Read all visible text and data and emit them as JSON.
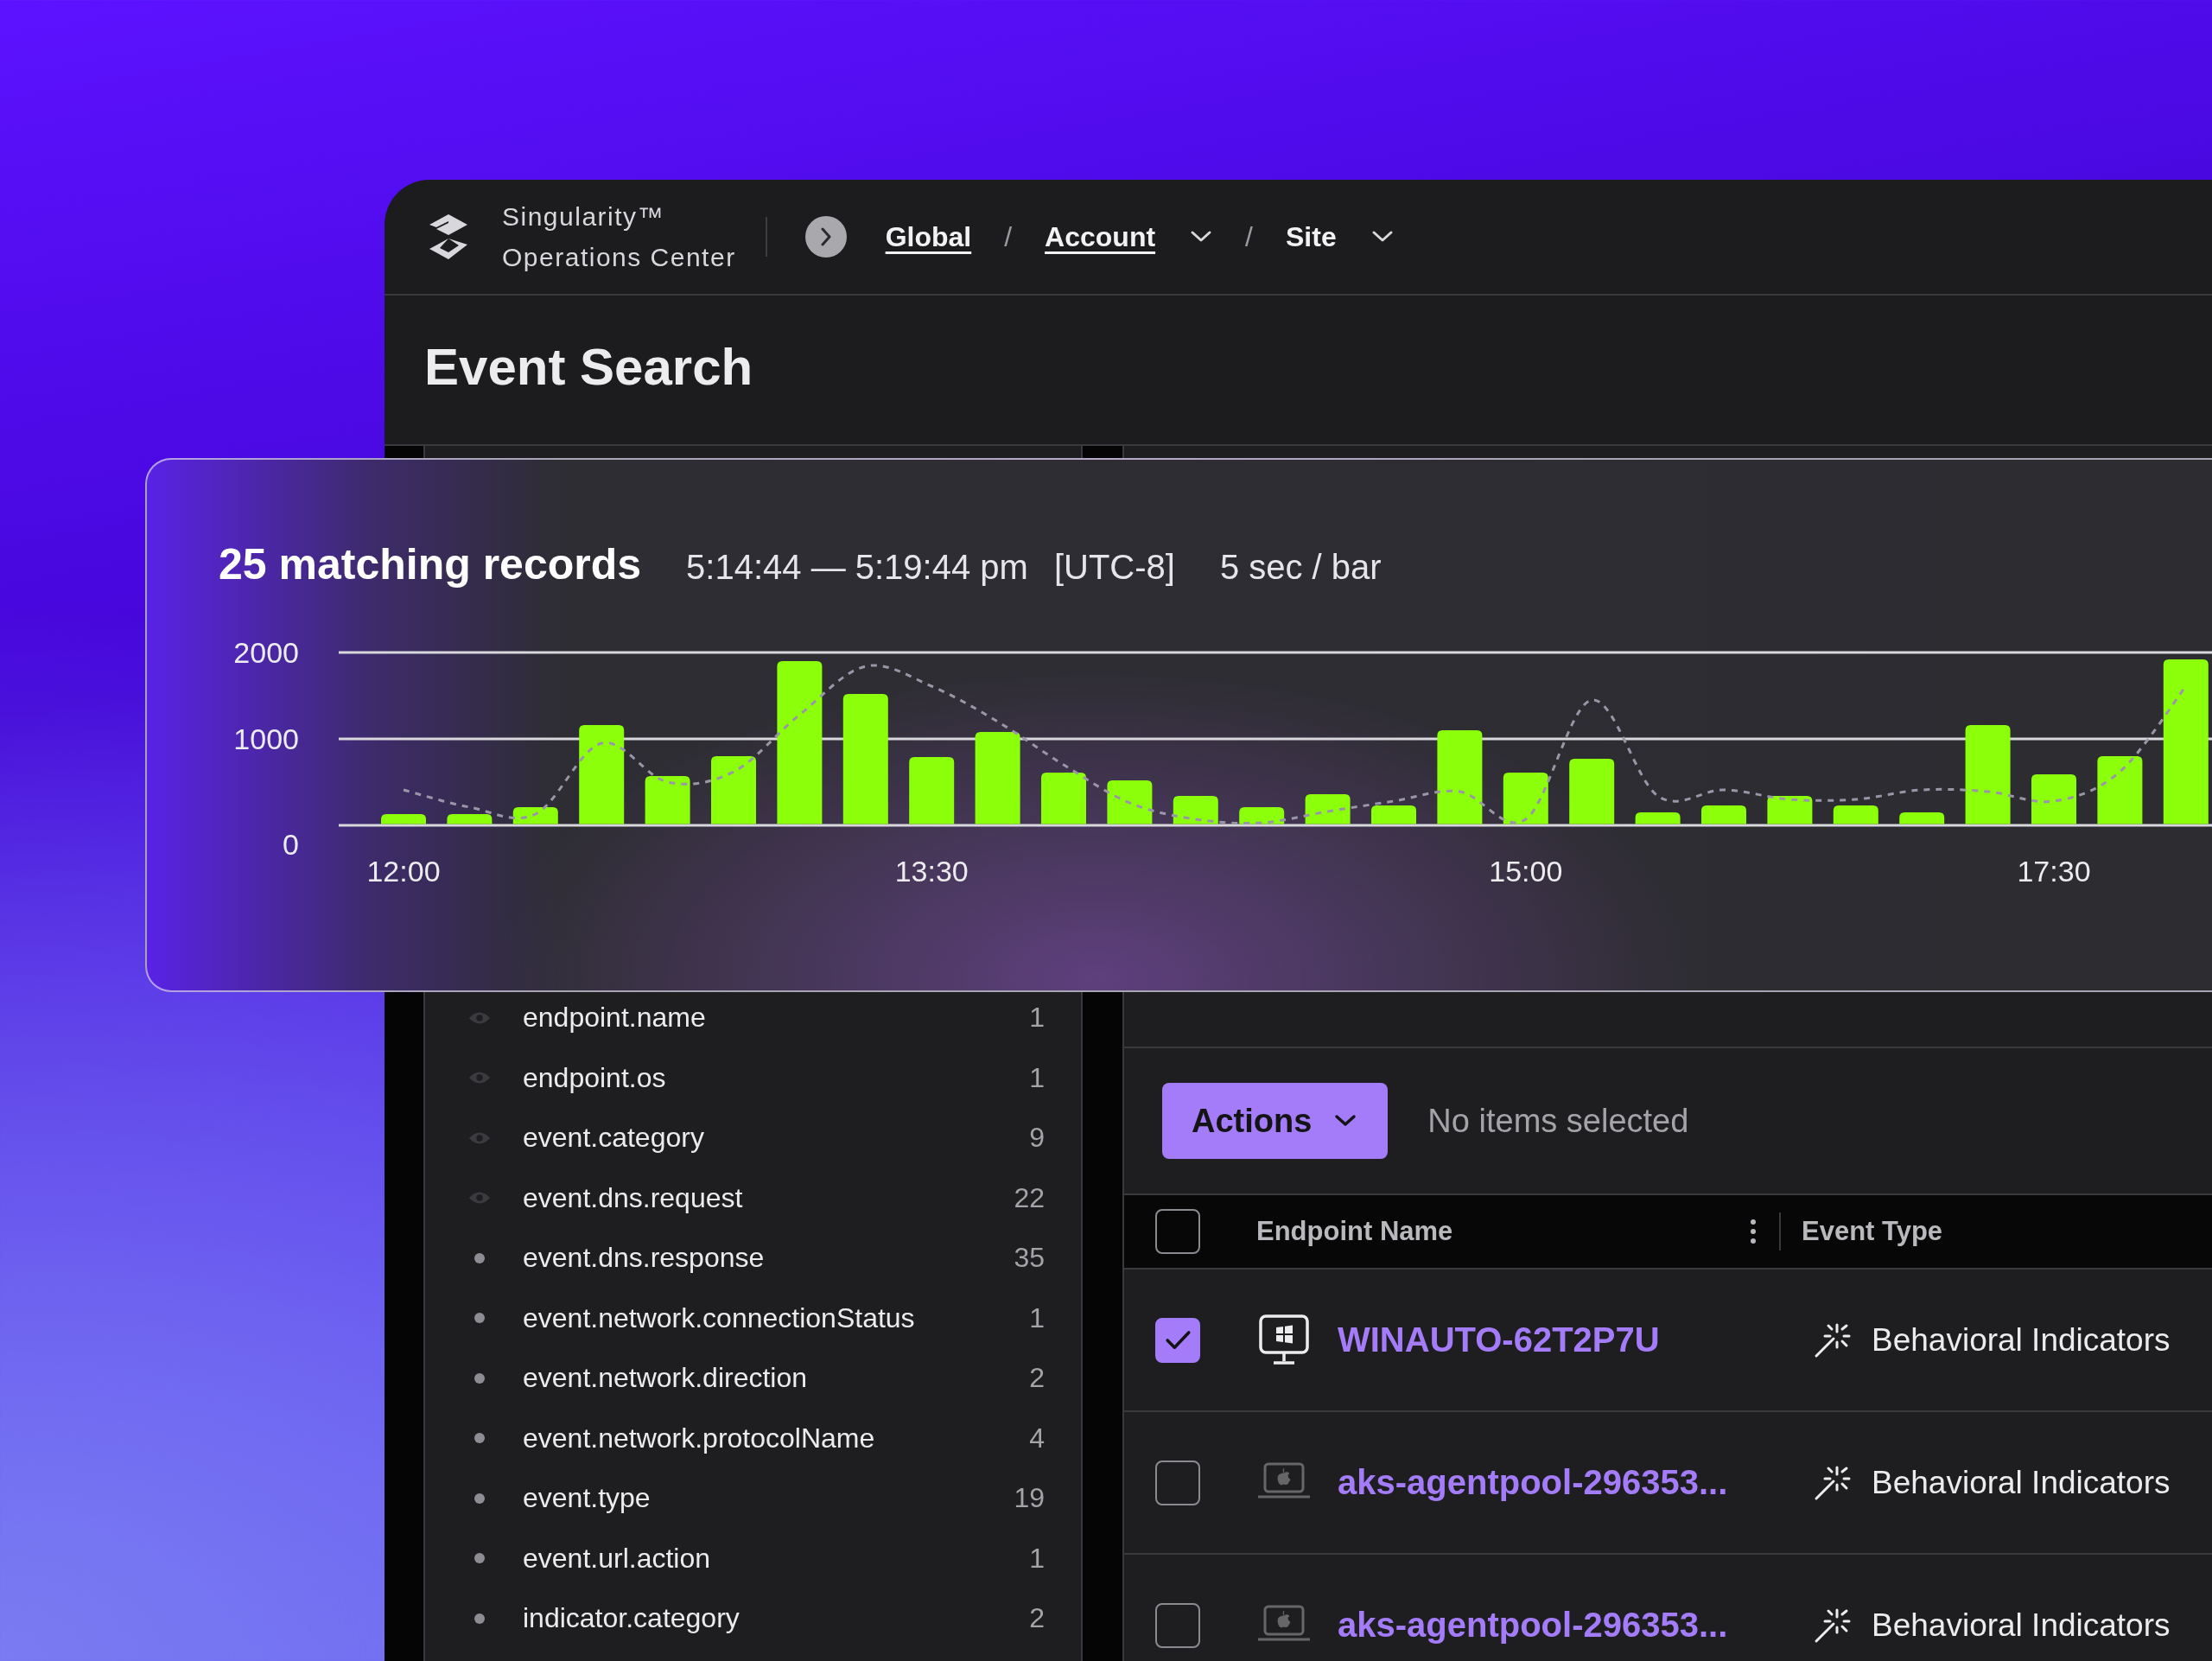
{
  "header": {
    "product_name": "Singularity™",
    "product_subtitle": "Operations Center",
    "breadcrumbs": [
      {
        "kind": "crumb",
        "label": "Global",
        "underlined": true,
        "dropdown": false
      },
      {
        "kind": "separator",
        "label": "/"
      },
      {
        "kind": "crumb",
        "label": "Account",
        "underlined": true,
        "dropdown": true
      },
      {
        "kind": "separator",
        "label": "/"
      },
      {
        "kind": "crumb",
        "label": "Site",
        "underlined": false,
        "dropdown": true
      }
    ]
  },
  "page_title": "Event Search",
  "histogram": {
    "title": "25 matching records",
    "time_range": "5:14:44 — 5:19:44 pm",
    "timezone": "[UTC-8]",
    "interval": "5 sec / bar",
    "chart_data": {
      "type": "bar",
      "categories": [
        "12:00",
        null,
        null,
        null,
        null,
        null,
        null,
        null,
        "13:30",
        null,
        null,
        null,
        null,
        null,
        null,
        null,
        null,
        "15:00",
        null,
        null,
        null,
        null,
        null,
        null,
        null,
        "17:30",
        null,
        null
      ],
      "series": [
        {
          "color": "#8cff0a",
          "values": [
            130,
            130,
            210,
            1160,
            570,
            800,
            1900,
            1520,
            790,
            1080,
            610,
            520,
            340,
            210,
            360,
            230,
            1100,
            610,
            770,
            150,
            230,
            340,
            230,
            150,
            1160,
            590,
            800,
            1920
          ]
        },
        {
          "type": "line",
          "line_style": "dashed",
          "color": "#9a96a8",
          "values": [
            410,
            210,
            130,
            950,
            500,
            620,
            1280,
            1840,
            1610,
            1200,
            700,
            260,
            70,
            30,
            160,
            280,
            390,
            70,
            1450,
            340,
            410,
            300,
            300,
            410,
            390,
            280,
            620,
            1610
          ]
        }
      ],
      "ylim": [
        0,
        2000
      ],
      "yticks": [
        0,
        1000,
        2000
      ]
    }
  },
  "fields_panel": {
    "items": [
      {
        "kind": "eye",
        "name": "endpoint.name",
        "count": "1"
      },
      {
        "kind": "eye",
        "name": "endpoint.os",
        "count": "1"
      },
      {
        "kind": "eye",
        "name": "event.category",
        "count": "9"
      },
      {
        "kind": "eye",
        "name": "event.dns.request",
        "count": "22"
      },
      {
        "kind": "dot",
        "name": "event.dns.response",
        "count": "35"
      },
      {
        "kind": "dot",
        "name": "event.network.connectionStatus",
        "count": "1"
      },
      {
        "kind": "dot",
        "name": "event.network.direction",
        "count": "2"
      },
      {
        "kind": "dot",
        "name": "event.network.protocolName",
        "count": "4"
      },
      {
        "kind": "dot",
        "name": "event.type",
        "count": "19"
      },
      {
        "kind": "dot",
        "name": "event.url.action",
        "count": "1"
      },
      {
        "kind": "dot",
        "name": "indicator.category",
        "count": "2"
      }
    ]
  },
  "toolbar": {
    "actions_button": "Actions",
    "selection_status": "No items selected"
  },
  "table": {
    "header_checkbox": {
      "checked": false
    },
    "columns": [
      {
        "label": "Endpoint Name"
      },
      {
        "label": "Event Type"
      }
    ],
    "rows": [
      {
        "checked": true,
        "kind": "monitor",
        "endpoint": "WINAUTO-62T2P7U",
        "event_type": "Behavioral Indicators"
      },
      {
        "checked": false,
        "kind": "laptop",
        "endpoint": "aks-agentpool-296353...",
        "event_type": "Behavioral Indicators"
      },
      {
        "checked": false,
        "kind": "laptop",
        "endpoint": "aks-agentpool-296353...",
        "event_type": "Behavioral Indicators"
      }
    ]
  }
}
